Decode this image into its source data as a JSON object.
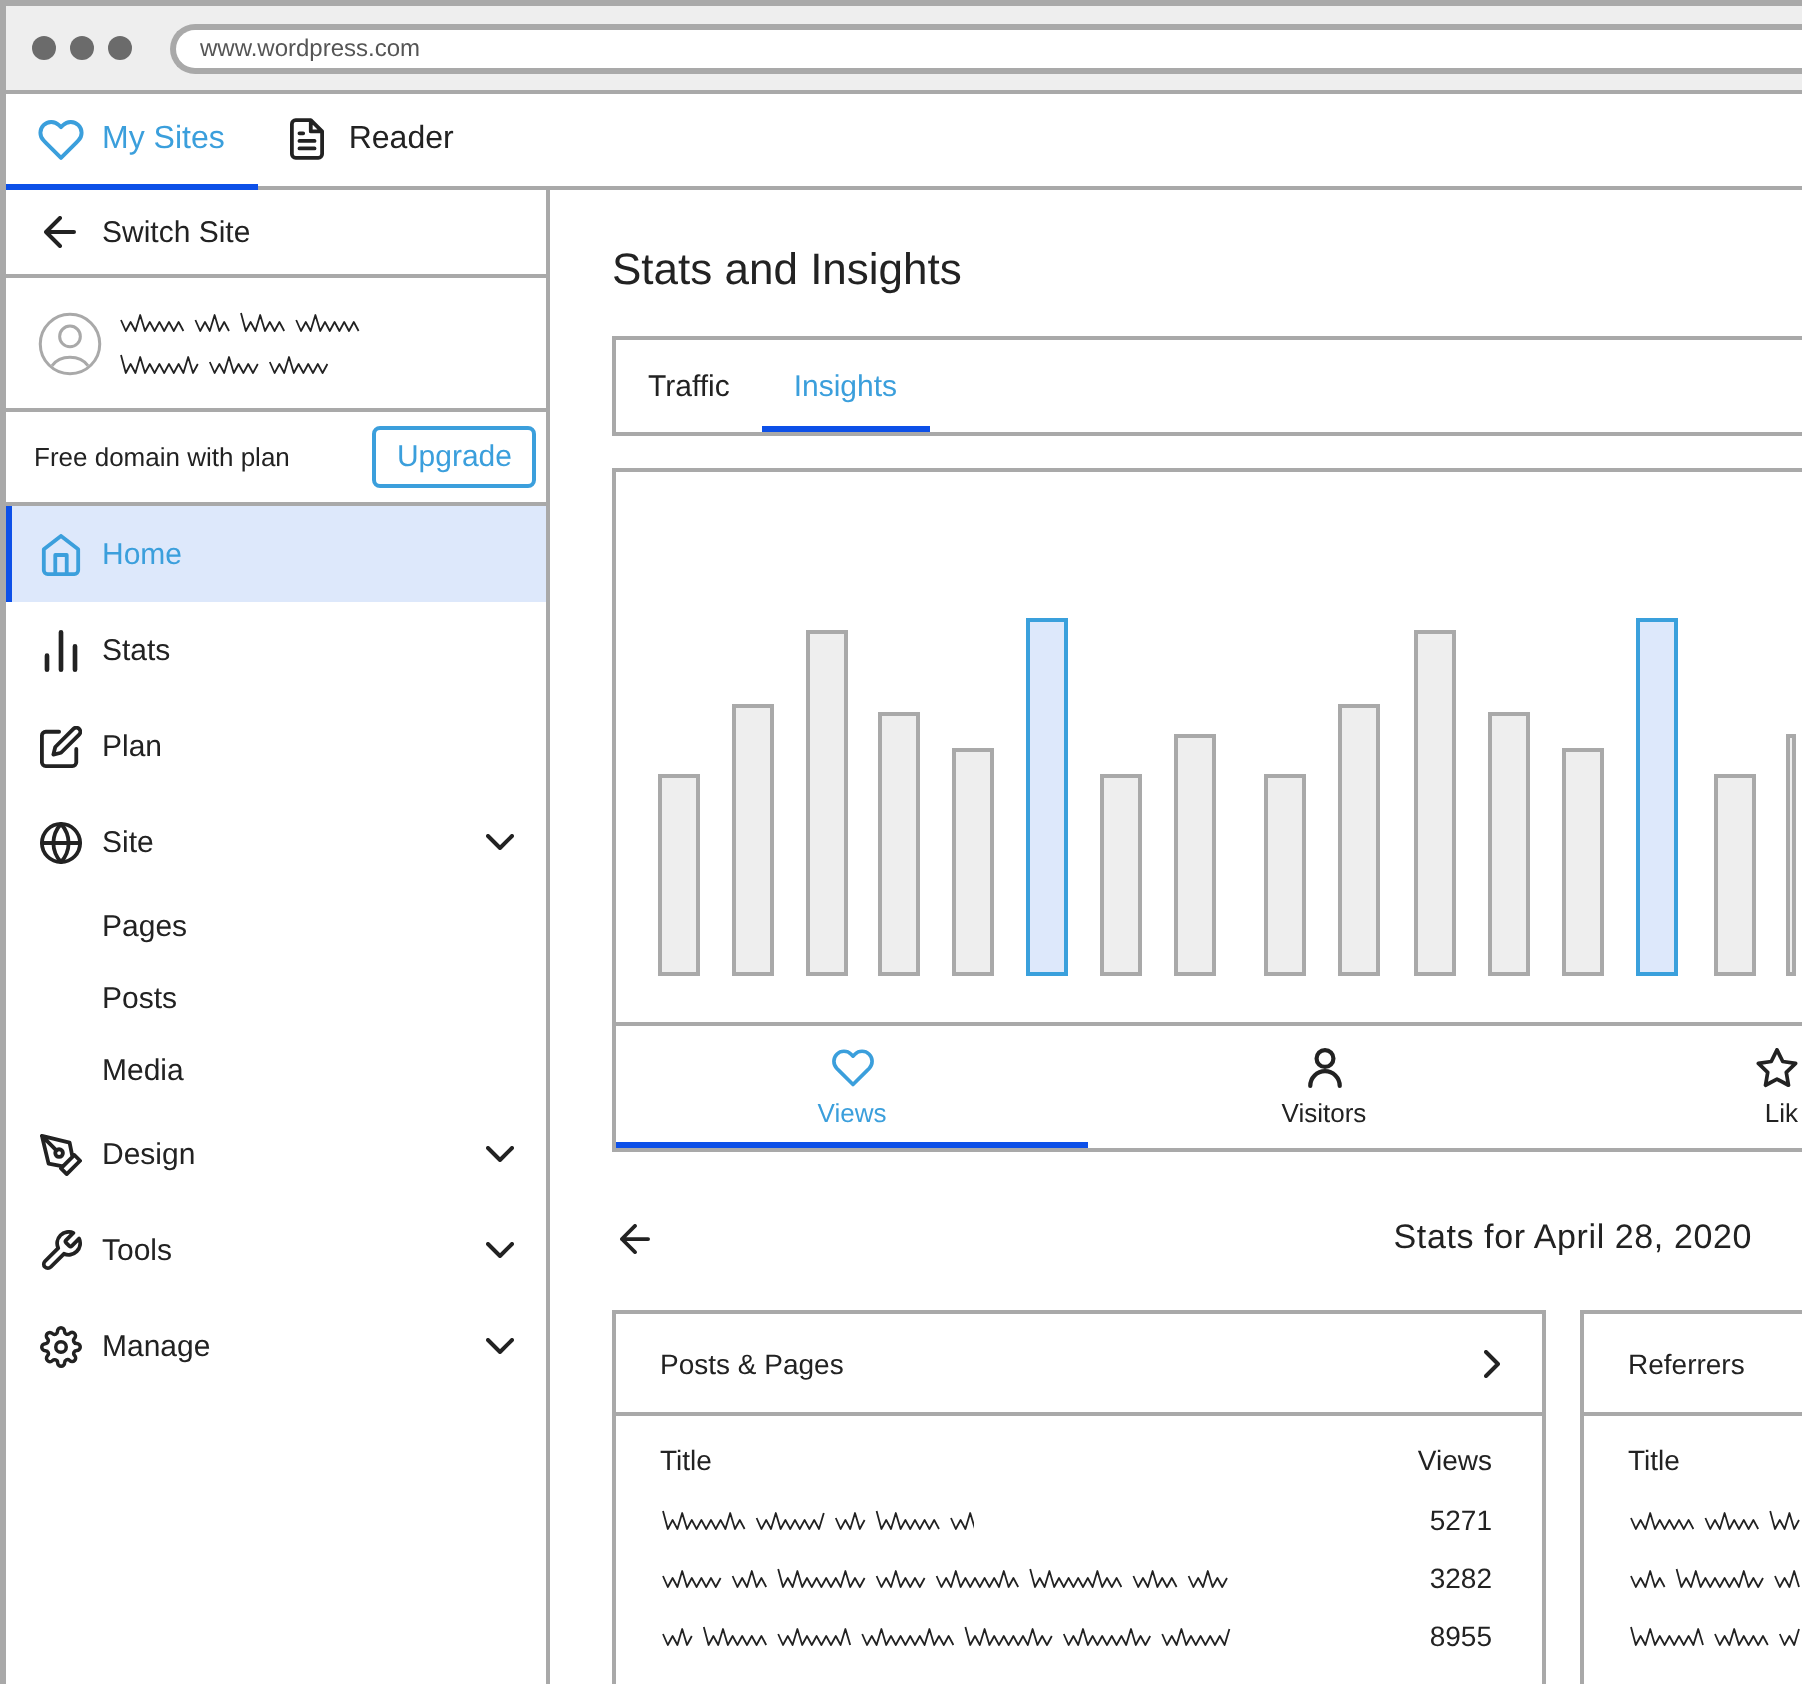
{
  "browser": {
    "url": "www.wordpress.com"
  },
  "top_nav": [
    {
      "label": "My Sites",
      "selected": true
    },
    {
      "label": "Reader",
      "selected": false
    }
  ],
  "sidebar": {
    "switch_site": "Switch Site",
    "promo": {
      "text": "Free domain with plan",
      "button": "Upgrade"
    },
    "items": [
      {
        "kind": "link",
        "label": "Home",
        "selected": true
      },
      {
        "kind": "link",
        "label": "Stats",
        "selected": false
      },
      {
        "kind": "link",
        "label": "Plan",
        "selected": false
      },
      {
        "kind": "group",
        "label": "Site",
        "selected": false,
        "children": [
          {
            "label": "Pages",
            "selected": false
          },
          {
            "label": "Posts",
            "selected": false
          },
          {
            "label": "Media",
            "selected": false
          }
        ]
      },
      {
        "kind": "group",
        "label": "Design",
        "selected": false
      },
      {
        "kind": "group",
        "label": "Tools",
        "selected": false
      },
      {
        "kind": "group",
        "label": "Manage",
        "selected": false
      }
    ]
  },
  "main": {
    "title": "Stats and Insights",
    "tabs": [
      {
        "label": "Traffic",
        "selected": false
      },
      {
        "label": "Insights",
        "selected": true
      }
    ],
    "chart": {
      "bars": [
        {
          "selected": false
        },
        {
          "selected": false
        },
        {
          "selected": false
        },
        {
          "selected": false
        },
        {
          "selected": false
        },
        {
          "selected": true
        },
        {
          "selected": false
        },
        {
          "selected": false
        },
        {
          "selected": false
        },
        {
          "selected": false
        },
        {
          "selected": false
        },
        {
          "selected": false
        },
        {
          "selected": false
        },
        {
          "selected": true
        },
        {
          "selected": false
        },
        {
          "selected": false
        }
      ]
    },
    "metric_tabs": [
      {
        "label": "Views",
        "selected": true
      },
      {
        "label": "Visitors",
        "selected": false
      },
      {
        "label": "Lik",
        "selected": false
      }
    ],
    "date_label": "Stats for April 28, 2020",
    "cards": [
      {
        "kind": "link",
        "title": "Posts & Pages",
        "columns": [
          "Title",
          "Views"
        ],
        "rows": [
          {
            "views": "5271"
          },
          {
            "views": "3282"
          },
          {
            "views": "8955"
          }
        ]
      },
      {
        "kind": "plain",
        "title": "Referrers",
        "columns": [
          "Title"
        ]
      }
    ]
  }
}
